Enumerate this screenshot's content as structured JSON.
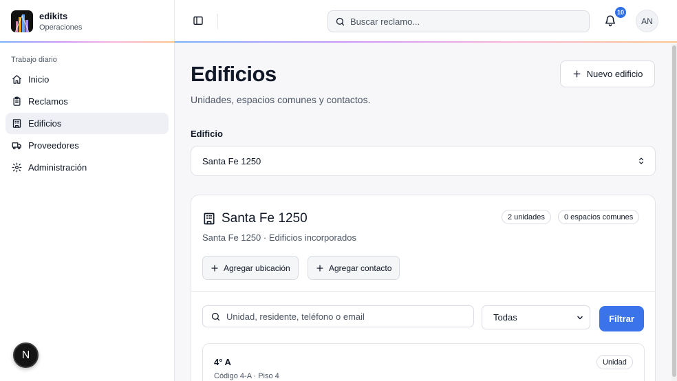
{
  "app": {
    "name": "edikits",
    "subtitle": "Operaciones"
  },
  "sidebar": {
    "section_label": "Trabajo diario",
    "items": [
      {
        "label": "Inicio",
        "icon": "home-icon",
        "active": false
      },
      {
        "label": "Reclamos",
        "icon": "clipboard-icon",
        "active": false
      },
      {
        "label": "Edificios",
        "icon": "building-icon",
        "active": true
      },
      {
        "label": "Proveedores",
        "icon": "truck-icon",
        "active": false
      },
      {
        "label": "Administración",
        "icon": "gear-icon",
        "active": false
      }
    ],
    "bottom_badge": "N"
  },
  "topbar": {
    "search_placeholder": "Buscar reclamo...",
    "notifications_count": "10",
    "avatar_initials": "AN"
  },
  "page": {
    "title": "Edificios",
    "subtitle": "Unidades, espacios comunes y contactos.",
    "new_button_label": "Nuevo edificio",
    "building_field_label": "Edificio",
    "selected_building": "Santa Fe 1250"
  },
  "building_card": {
    "name": "Santa Fe 1250",
    "units_badge": "2 unidades",
    "common_spaces_badge": "0 espacios comunes",
    "description": "Santa Fe 1250 · Edificios incorporados",
    "add_location_label": "Agregar ubicación",
    "add_contact_label": "Agregar contacto",
    "filter_placeholder": "Unidad, residente, teléfono o email",
    "filter_selected": "Todas",
    "filter_button_label": "Filtrar"
  },
  "units": [
    {
      "name": "4° A",
      "type": "Unidad",
      "meta": "Código 4-A · Piso 4"
    }
  ],
  "colors": {
    "accent": "#3b73ea",
    "badge": "#2f6fe6",
    "active_nav_bg": "#eef0f5"
  }
}
